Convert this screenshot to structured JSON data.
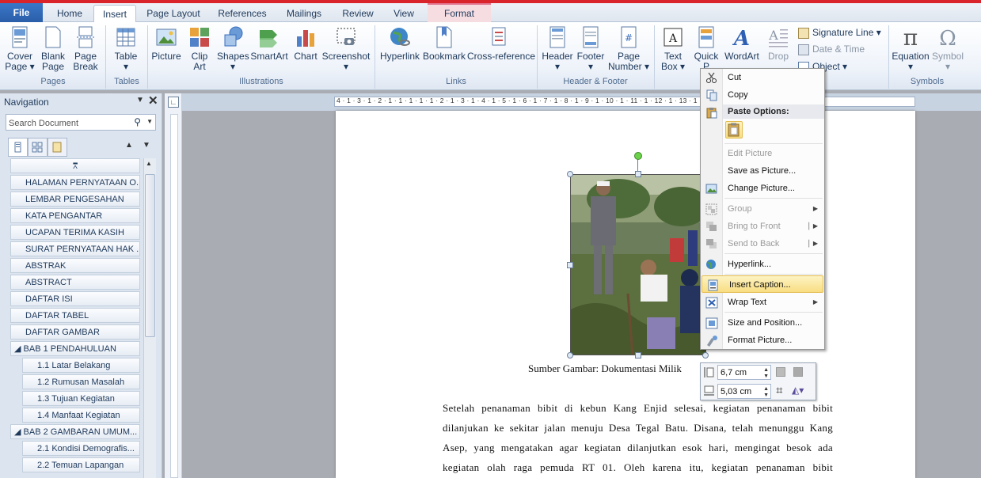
{
  "tabs": [
    "File",
    "Home",
    "Insert",
    "Page Layout",
    "References",
    "Mailings",
    "Review",
    "View",
    "Format"
  ],
  "ribbon": {
    "pages": {
      "cover": "Cover\nPage ▾",
      "blank": "Blank\nPage",
      "break": "Page\nBreak",
      "group": "Pages"
    },
    "tables": {
      "table": "Table\n▾",
      "group": "Tables"
    },
    "illustrations": {
      "picture": "Picture",
      "clipart": "Clip\nArt",
      "shapes": "Shapes\n▾",
      "smartart": "SmartArt",
      "chart": "Chart",
      "screenshot": "Screenshot\n▾",
      "group": "Illustrations"
    },
    "links": {
      "hyperlink": "Hyperlink",
      "bookmark": "Bookmark",
      "crossref": "Cross-reference",
      "group": "Links"
    },
    "headerfooter": {
      "header": "Header\n▾",
      "footer": "Footer\n▾",
      "pagenumber": "Page\nNumber ▾",
      "group": "Header & Footer"
    },
    "text": {
      "textbox": "Text\nBox ▾",
      "quickparts": "Quick\nP",
      "wordart": "WordArt",
      "dropcap": "Drop",
      "signature": "Signature Line ▾",
      "datetime": "Date & Time",
      "object": "Object ▾"
    },
    "symbols": {
      "equation": "Equation\n▾",
      "symbol": "Symbol\n▾",
      "group": "Symbols"
    }
  },
  "nav": {
    "title": "Navigation",
    "search_placeholder": "Search Document",
    "headings": [
      "HALAMAN PERNYATAAN O...",
      "LEMBAR PENGESAHAN",
      "KATA PENGANTAR",
      "UCAPAN TERIMA KASIH",
      "SURAT PERNYATAAN HAK ...",
      "ABSTRAK",
      "ABSTRACT",
      "DAFTAR ISI",
      "DAFTAR TABEL",
      "DAFTAR GAMBAR",
      "◢ BAB 1  PENDAHULUAN",
      "1.1 Latar Belakang",
      "1.2 Rumusan Masalah",
      "1.3 Tujuan Kegiatan",
      "1.4 Manfaat Kegiatan",
      "◢ BAB 2 GAMBARAN UMUM...",
      "2.1 Kondisi Demografis...",
      "2.2 Temuan Lapangan"
    ]
  },
  "ruler": {
    "h": "4 · 1 · 3 · 1 · 2 · 1 · 1 · 1 · 1 · 1 · 2 · 1 · 3 · 1 · 4 · 1 · 5 · 1 · 6 · 1 · 7 · 1 · 8 · 1 · 9 · 1 · 10 · 1 · 11 · 1 · 12 · 1 · 13 · 1 · 14 · 1 · 15 · 1 · 16 · 1 · 17 · 1"
  },
  "document": {
    "caption": "Sumber Gambar: Dokumentasi Milik",
    "lines": [
      "Setelah penanaman bibit di kebun Kang Enjid selesai, kegiatan penanaman bibit",
      "dilanjukan ke sekitar jalan menuju Desa Tegal Batu. Disana, telah menunggu Kang",
      "Asep, yang mengatakan agar kegiatan dilanjutkan esok hari, mengingat besok ada",
      "kegiatan olah raga pemuda RT 01. Oleh karena itu, kegiatan penanaman bibit"
    ]
  },
  "context_menu": {
    "cut": "Cut",
    "copy": "Copy",
    "paste_options": "Paste Options:",
    "edit_picture": "Edit Picture",
    "save_as_picture": "Save as Picture...",
    "change_picture": "Change Picture...",
    "group": "Group",
    "bring_to_front": "Bring to Front",
    "send_to_back": "Send to Back",
    "hyperlink": "Hyperlink...",
    "insert_caption": "Insert Caption...",
    "wrap_text": "Wrap Text",
    "size_position": "Size and Position...",
    "format_picture": "Format Picture..."
  },
  "mini_toolbar": {
    "height": "6,7 cm",
    "width": "5,03 cm"
  },
  "colors": {
    "accent_red": "#d8242a",
    "file_tab": "#2a5ea8",
    "highlight": "#f8dd82"
  }
}
